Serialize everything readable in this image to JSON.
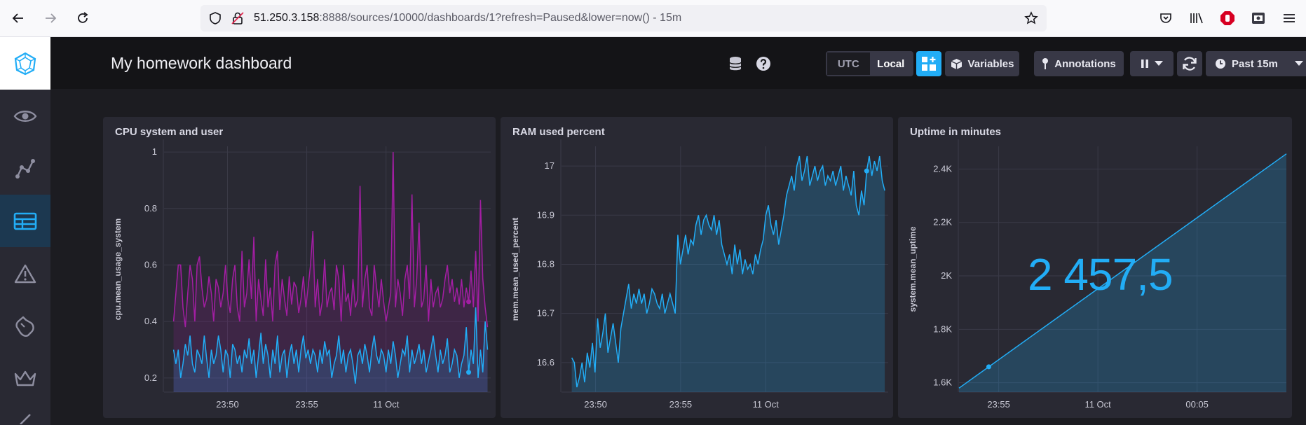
{
  "browser": {
    "url_host": "51.250.3.158",
    "url_rest": ":8888/sources/10000/dashboards/1?refresh=Paused&lower=now() - 15m"
  },
  "sidebar": {
    "items": [
      {
        "icon": "eye-icon"
      },
      {
        "icon": "graph-nodes-icon"
      },
      {
        "icon": "dashboards-grid-icon",
        "active": true
      },
      {
        "icon": "alert-triangle-icon"
      },
      {
        "icon": "wrench-icon"
      },
      {
        "icon": "crown-icon"
      }
    ]
  },
  "header": {
    "title": "My homework dashboard",
    "tz_utc": "UTC",
    "tz_local": "Local",
    "variables_label": "Variables",
    "annotations_label": "Annotations",
    "time_range_label": "Past 15m"
  },
  "colors": {
    "accent_blue": "#22adf6",
    "purple": "#a31ea3",
    "header_bg": "#141417",
    "panel_bg": "#292933"
  },
  "panels": [
    {
      "title": "CPU system and user"
    },
    {
      "title": "RAM used percent"
    },
    {
      "title": "Uptime in minutes",
      "stat_value": "2 457,5"
    }
  ],
  "chart_data": [
    {
      "type": "line",
      "title": "CPU system and user",
      "ylabel": "cpu.mean_usage_system",
      "ylim": [
        0.15,
        1.02
      ],
      "y_ticks": [
        "0.2",
        "0.4",
        "0.6",
        "0.8",
        "1"
      ],
      "x_ticks": [
        "23:50",
        "23:55",
        "11 Oct"
      ],
      "x_range_minutes": [
        -19,
        1.6
      ],
      "x_tick_minutes": [
        -15,
        -10,
        -5
      ],
      "series": [
        {
          "color": "#a31ea3",
          "values": [
            0.4,
            0.5,
            0.6,
            0.6,
            0.45,
            0.38,
            0.5,
            0.6,
            0.55,
            0.4,
            0.6,
            0.63,
            0.52,
            0.45,
            0.48,
            0.56,
            0.5,
            0.4,
            0.55,
            0.52,
            0.45,
            0.5,
            0.6,
            0.48,
            0.43,
            0.55,
            0.6,
            0.45,
            0.4,
            0.65,
            0.45,
            0.5,
            0.62,
            0.48,
            0.7,
            0.4,
            0.55,
            0.48,
            0.42,
            0.62,
            0.45,
            0.52,
            0.4,
            0.6,
            0.65,
            0.44,
            0.55,
            0.48,
            0.42,
            0.56,
            0.46,
            0.54,
            0.52,
            0.43,
            0.48,
            0.56,
            0.45,
            0.52,
            0.6,
            0.72,
            0.45,
            0.55,
            0.42,
            0.47,
            0.62,
            0.45,
            0.5,
            0.52,
            0.44,
            0.6,
            0.55,
            0.4,
            0.6,
            0.47,
            0.5,
            0.42,
            0.55,
            0.45,
            0.48,
            0.88,
            0.45,
            0.55,
            0.6,
            0.45,
            0.42,
            0.6,
            0.52,
            0.45,
            0.55,
            0.47,
            0.4,
            0.45,
            0.5,
            1.0,
            0.45,
            0.55,
            0.5,
            0.42,
            0.55,
            0.6,
            0.48,
            0.85,
            0.45,
            0.55,
            0.75,
            0.45,
            0.48,
            0.6,
            0.4,
            0.55,
            0.45,
            0.5,
            0.52,
            0.45,
            0.48,
            0.55,
            0.6,
            0.5,
            0.55,
            0.47,
            0.52,
            0.46,
            0.55,
            0.45,
            0.52,
            0.47,
            0.58,
            0.45,
            0.65,
            0.4,
            0.83,
            0.55,
            0.45,
            0.38
          ]
        },
        {
          "color": "#22adf6",
          "values": [
            0.3,
            0.25,
            0.3,
            0.2,
            0.25,
            0.32,
            0.28,
            0.35,
            0.25,
            0.22,
            0.3,
            0.28,
            0.25,
            0.35,
            0.27,
            0.2,
            0.3,
            0.25,
            0.28,
            0.35,
            0.3,
            0.22,
            0.3,
            0.28,
            0.2,
            0.32,
            0.3,
            0.25,
            0.28,
            0.22,
            0.3,
            0.27,
            0.34,
            0.25,
            0.3,
            0.2,
            0.28,
            0.36,
            0.25,
            0.32,
            0.28,
            0.2,
            0.3,
            0.25,
            0.35,
            0.22,
            0.28,
            0.3,
            0.2,
            0.28,
            0.32,
            0.25,
            0.3,
            0.22,
            0.3,
            0.35,
            0.27,
            0.3,
            0.25,
            0.3,
            0.28,
            0.22,
            0.3,
            0.25,
            0.33,
            0.28,
            0.3,
            0.2,
            0.25,
            0.28,
            0.35,
            0.25,
            0.3,
            0.22,
            0.28,
            0.3,
            0.25,
            0.18,
            0.28,
            0.3,
            0.25,
            0.32,
            0.28,
            0.22,
            0.3,
            0.35,
            0.28,
            0.25,
            0.3,
            0.28,
            0.22,
            0.3,
            0.25,
            0.33,
            0.28,
            0.2,
            0.25,
            0.3,
            0.28,
            0.35,
            0.22,
            0.3,
            0.25,
            0.28,
            0.32,
            0.25,
            0.3,
            0.22,
            0.26,
            0.3,
            0.35,
            0.28,
            0.22,
            0.3,
            0.25,
            0.28,
            0.34,
            0.22,
            0.25,
            0.3,
            0.28,
            0.2,
            0.25,
            0.28,
            0.38,
            0.22,
            0.3,
            0.25,
            0.45,
            0.2,
            0.3,
            0.22,
            0.4,
            0.3
          ]
        }
      ]
    },
    {
      "type": "area",
      "title": "RAM used percent",
      "ylabel": "mem.mean_used_percent",
      "ylim": [
        16.54,
        17.04
      ],
      "y_ticks": [
        "16.6",
        "16.7",
        "16.8",
        "16.9",
        "17"
      ],
      "x_ticks": [
        "23:50",
        "23:55",
        "11 Oct"
      ],
      "x_range_minutes": [
        -17,
        2.2
      ],
      "x_tick_minutes": [
        -15,
        -10,
        -5
      ],
      "series": [
        {
          "color": "#22adf6",
          "values": [
            16.61,
            16.6,
            16.55,
            16.57,
            16.6,
            16.56,
            16.62,
            16.59,
            16.64,
            16.58,
            16.69,
            16.63,
            16.66,
            16.7,
            16.62,
            16.65,
            16.68,
            16.64,
            16.6,
            16.67,
            16.7,
            16.73,
            16.76,
            16.71,
            16.74,
            16.72,
            16.75,
            16.72,
            16.74,
            16.7,
            16.72,
            16.75,
            16.74,
            16.72,
            16.71,
            16.74,
            16.7,
            16.72,
            16.74,
            16.72,
            16.7,
            16.86,
            16.8,
            16.83,
            16.86,
            16.82,
            16.85,
            16.84,
            16.88,
            16.9,
            16.86,
            16.89,
            16.9,
            16.88,
            16.87,
            16.9,
            16.86,
            16.89,
            16.84,
            16.82,
            16.8,
            16.82,
            16.78,
            16.84,
            16.8,
            16.83,
            16.78,
            16.81,
            16.79,
            16.8,
            16.78,
            16.82,
            16.8,
            16.83,
            16.85,
            16.9,
            16.92,
            16.88,
            16.86,
            16.89,
            16.84,
            16.87,
            16.9,
            16.94,
            16.96,
            16.98,
            16.95,
            17.0,
            17.02,
            16.97,
            16.99,
            17.02,
            16.96,
            16.98,
            17.0,
            16.97,
            16.99,
            17.0,
            16.96,
            16.98,
            16.97,
            16.99,
            16.96,
            16.98,
            17.0,
            16.95,
            16.98,
            16.96,
            16.94,
            16.99,
            16.92,
            16.9,
            16.95,
            16.92,
            16.99,
            17.02,
            16.98,
            17.01,
            16.99,
            17.02,
            16.97,
            16.95
          ]
        }
      ]
    },
    {
      "type": "area",
      "title": "Uptime in minutes",
      "ylabel": "system.mean_uptime",
      "ylim": [
        1.565,
        2.485
      ],
      "y_unit": "K",
      "y_ticks": [
        "1.6K",
        "1.8K",
        "2K",
        "2.2K",
        "2.4K"
      ],
      "x_ticks": [
        "23:55",
        "11 Oct",
        "00:05"
      ],
      "x_range_minutes": [
        -12,
        4.5
      ],
      "x_tick_minutes": [
        -10,
        -5,
        0
      ],
      "series": [
        {
          "color": "#22adf6",
          "values": [
            1.58,
            2.457
          ]
        }
      ]
    }
  ]
}
